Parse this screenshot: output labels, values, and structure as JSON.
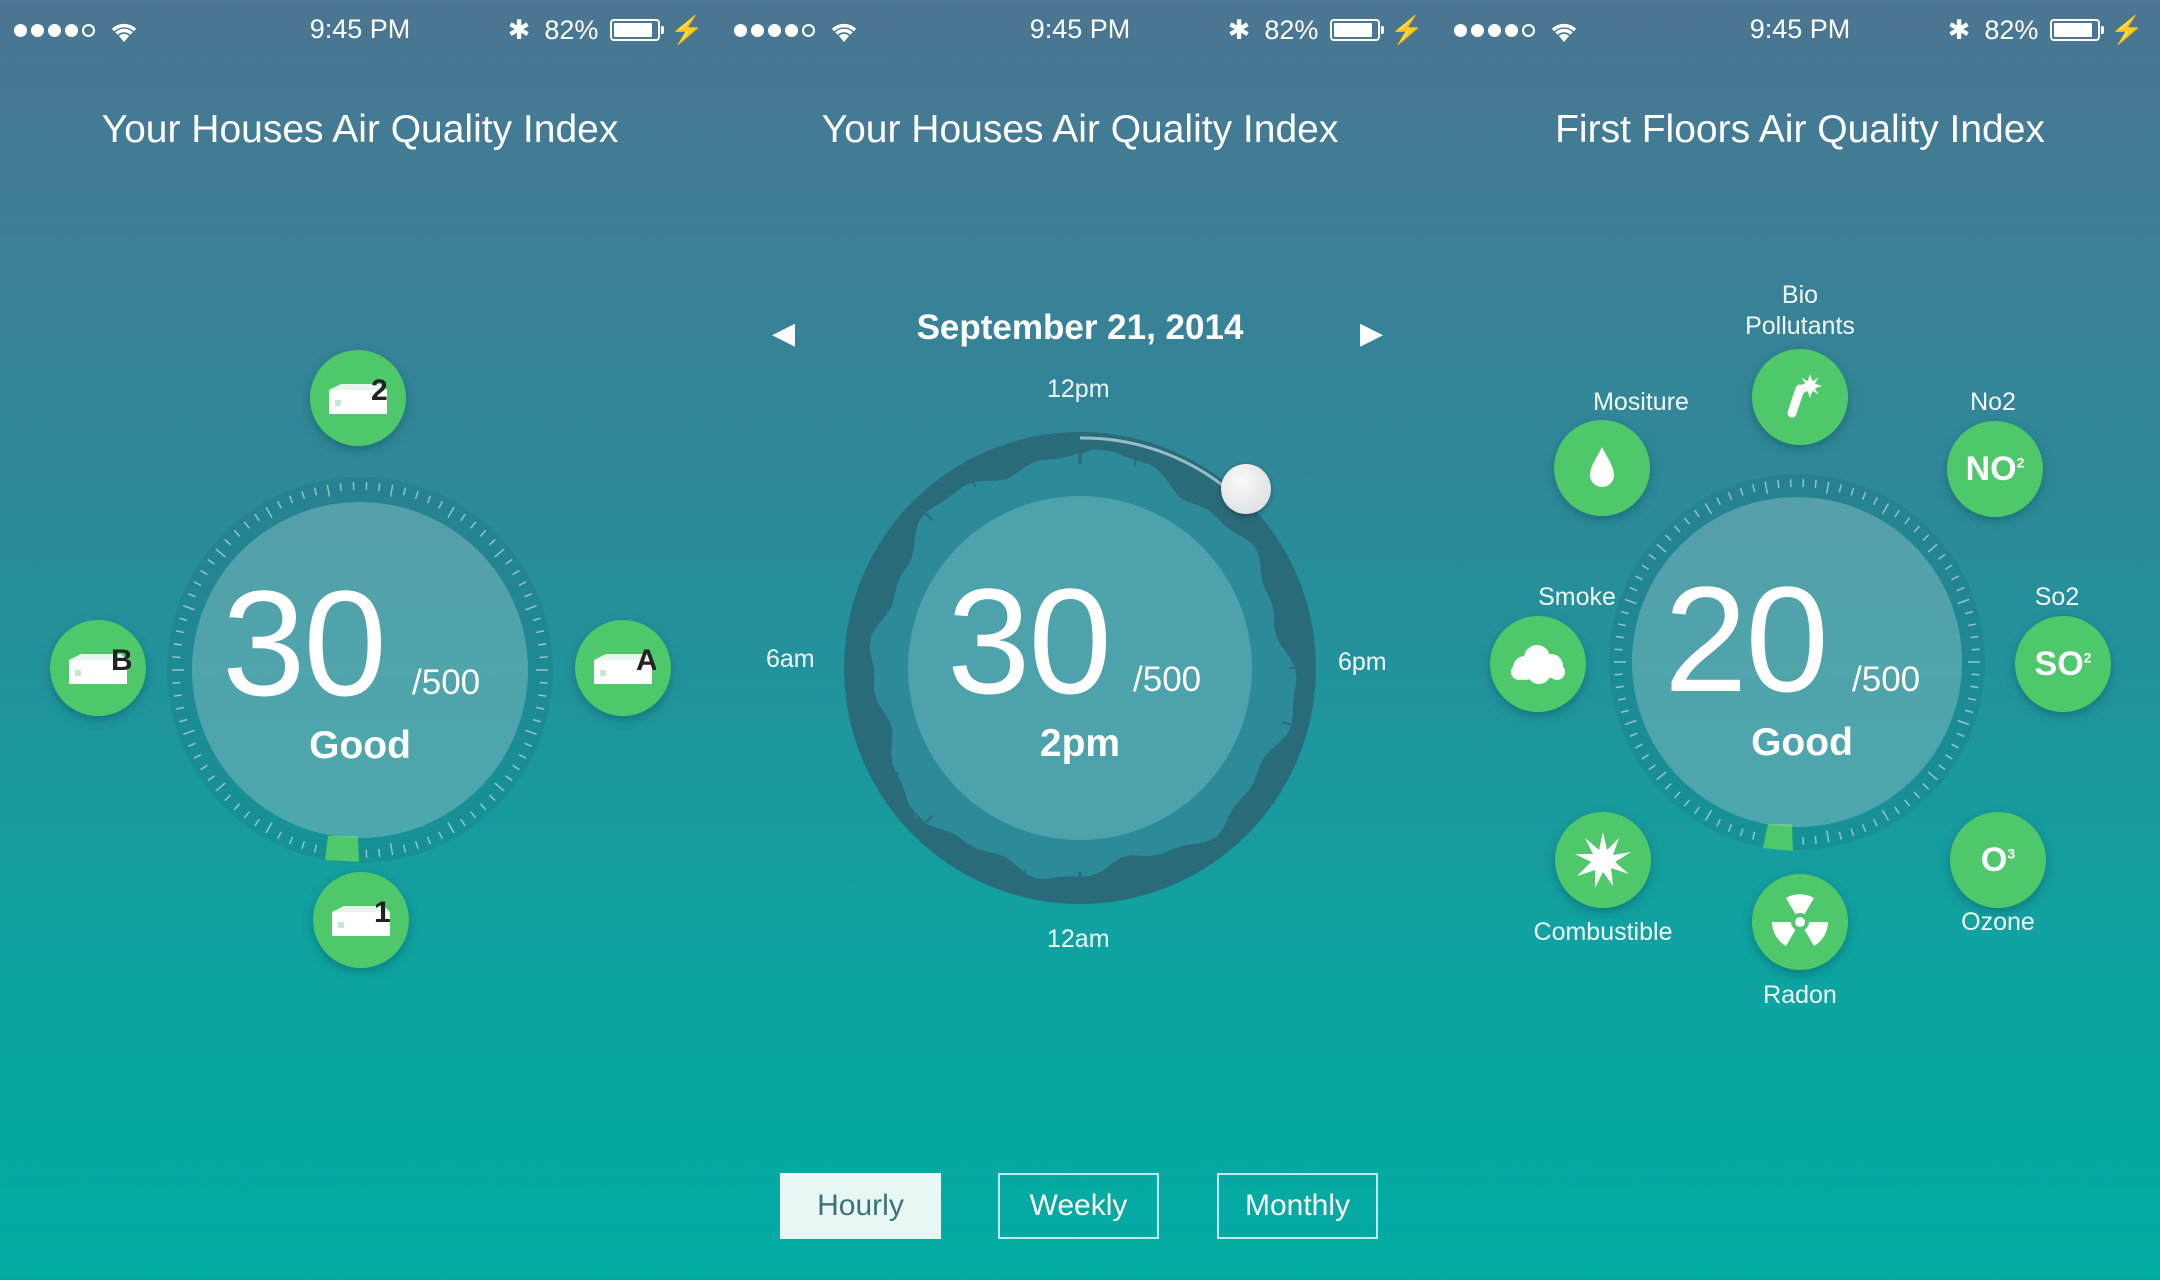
{
  "status_bar": {
    "time": "9:45 PM",
    "battery": "82%",
    "battery_level": 0.82,
    "bluetooth": "✱",
    "bolt": "⚡"
  },
  "panels": [
    {
      "title": "Your Houses Air Quality Index",
      "score": "30",
      "max": "/500",
      "status": "Good",
      "devices": [
        {
          "label": "2",
          "icon": "device-icon"
        },
        {
          "label": "B",
          "icon": "device-icon"
        },
        {
          "label": "A",
          "icon": "device-icon"
        },
        {
          "label": "1",
          "icon": "device-icon"
        }
      ]
    },
    {
      "title": "Your Houses Air Quality Index",
      "date": "September 21, 2014",
      "prev_icon": "◀",
      "next_icon": "▶",
      "score": "30",
      "max": "/500",
      "time_label": "2pm",
      "hours": {
        "top": "12pm",
        "right": "6pm",
        "bottom": "12am",
        "left": "6am"
      },
      "tabs": [
        "Hourly",
        "Weekly",
        "Monthly"
      ],
      "active_tab": "Hourly"
    },
    {
      "title": "First Floors Air Quality Index",
      "score": "20",
      "max": "/500",
      "status": "Good",
      "pollutants": {
        "bio": {
          "line1": "Bio",
          "line2": "Pollutants"
        },
        "moisture": "Mositure",
        "no2": {
          "label": "No2",
          "symbol": "NO",
          "sup": "2"
        },
        "smoke": "Smoke",
        "so2": {
          "label": "So2",
          "symbol": "SO",
          "sup": "2"
        },
        "combustible": "Combustible",
        "radon": "Radon",
        "ozone": {
          "label": "Ozone",
          "symbol": "O",
          "sup": "3"
        }
      }
    }
  ],
  "colors": {
    "accent_green": "#4ec86a",
    "bg_top": "#4b7592",
    "bg_bottom": "#01aca3"
  }
}
